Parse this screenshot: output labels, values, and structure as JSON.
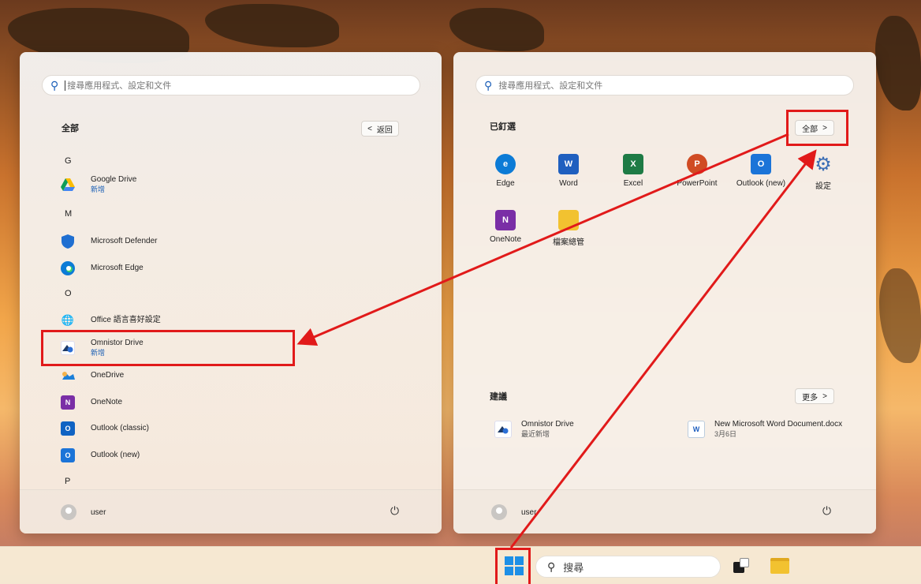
{
  "left_panel": {
    "search_placeholder": "搜尋應用程式、設定和文件",
    "section_title": "全部",
    "back_label": "返回",
    "back_chevron": "<",
    "letters": [
      "G",
      "M",
      "O",
      "P"
    ],
    "apps": [
      {
        "name": "Google Drive",
        "sub": "新增",
        "icon": "google-drive-icon",
        "color": "#34a853"
      },
      {
        "name": "Microsoft Defender",
        "sub": "",
        "icon": "shield-icon",
        "color": "#1f6fd1"
      },
      {
        "name": "Microsoft Edge",
        "sub": "",
        "icon": "edge-icon",
        "color": "#0c7bd6"
      },
      {
        "name": "Office 語言喜好設定",
        "sub": "",
        "icon": "language-icon",
        "color": "#4f7ebd"
      },
      {
        "name": "Omnistor Drive",
        "sub": "新增",
        "icon": "omnistor-drive-icon",
        "color": "#1e3a66"
      },
      {
        "name": "OneDrive",
        "sub": "",
        "icon": "onedrive-icon",
        "color": "#1a7fd9"
      },
      {
        "name": "OneNote",
        "sub": "",
        "icon": "onenote-icon",
        "color": "#7a2ea6"
      },
      {
        "name": "Outlook (classic)",
        "sub": "",
        "icon": "outlook-classic-icon",
        "color": "#0f63c3"
      },
      {
        "name": "Outlook (new)",
        "sub": "",
        "icon": "outlook-new-icon",
        "color": "#1b74d8"
      }
    ],
    "user": "user"
  },
  "right_panel": {
    "search_placeholder": "搜尋應用程式、設定和文件",
    "pinned_title": "已釘選",
    "all_label": "全部",
    "all_chevron": ">",
    "pinned": [
      {
        "name": "Edge",
        "icon": "edge-icon",
        "color": "#0c7bd6",
        "glyph": "e"
      },
      {
        "name": "Word",
        "icon": "word-icon",
        "color": "#1f5fbf",
        "glyph": "W"
      },
      {
        "name": "Excel",
        "icon": "excel-icon",
        "color": "#1e7b45",
        "glyph": "X"
      },
      {
        "name": "PowerPoint",
        "icon": "powerpoint-icon",
        "color": "#d04b23",
        "glyph": "P"
      },
      {
        "name": "Outlook (new)",
        "icon": "outlook-new-icon",
        "color": "#1b74d8",
        "glyph": "O"
      },
      {
        "name": "設定",
        "icon": "gear-icon",
        "color": "#3d6fb5",
        "glyph": "⚙"
      },
      {
        "name": "OneNote",
        "icon": "onenote-icon",
        "color": "#7a2ea6",
        "glyph": "N"
      },
      {
        "name": "檔案總管",
        "icon": "folder-icon",
        "color": "#f2c230",
        "glyph": ""
      }
    ],
    "recommended_title": "建議",
    "more_label": "更多",
    "more_chevron": ">",
    "recommended": [
      {
        "name": "Omnistor Drive",
        "sub": "最近新增",
        "icon": "omnistor-drive-icon"
      },
      {
        "name": "New Microsoft Word Document.docx",
        "sub": "3月6日",
        "icon": "word-document-icon"
      }
    ],
    "user": "user"
  },
  "taskbar": {
    "search_label": "搜尋"
  },
  "colors": {
    "annotation_red": "#e11a1a",
    "accent_blue": "#1a5fb4"
  }
}
